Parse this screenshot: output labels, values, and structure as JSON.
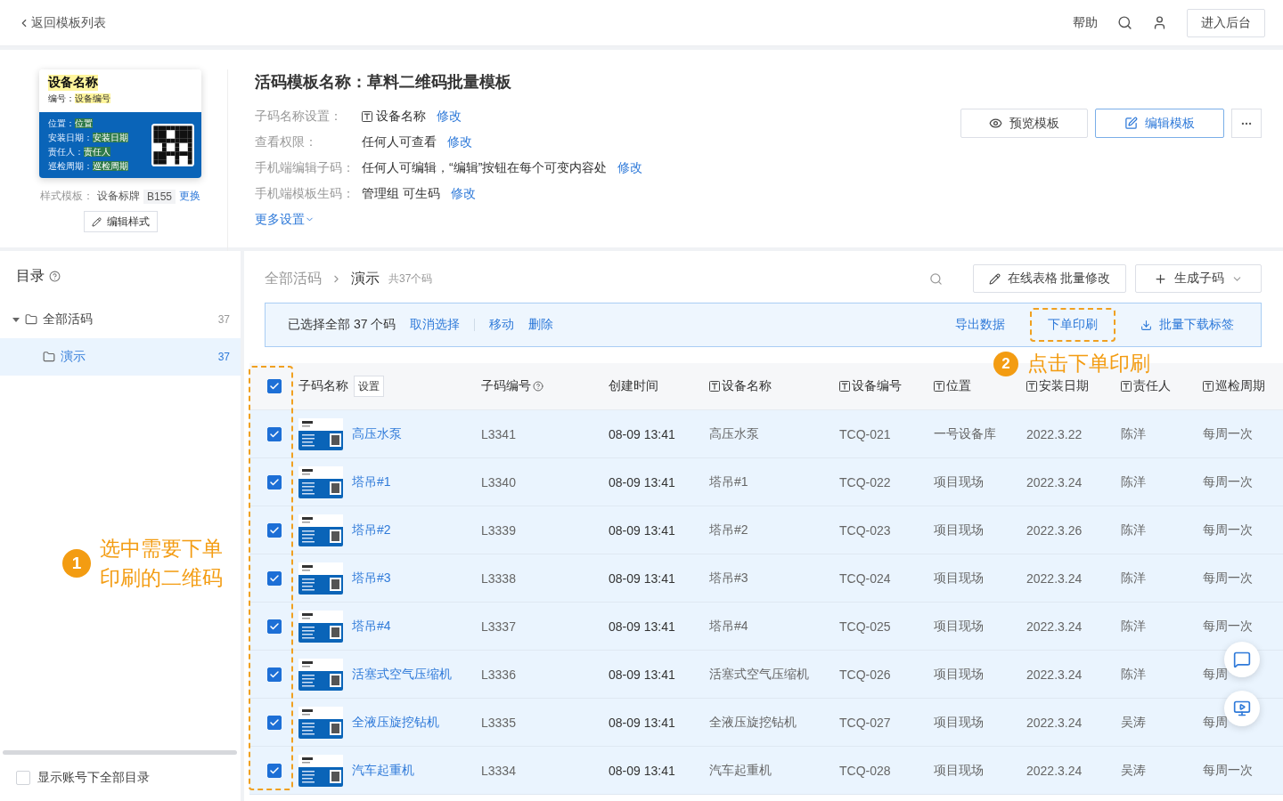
{
  "topbar": {
    "back_link": "返回模板列表",
    "help": "帮助",
    "admin_button": "进入后台"
  },
  "template": {
    "preview": {
      "title": "设备名称",
      "code_label": "编号：",
      "code_value": "设备编号",
      "fields": [
        {
          "label": "位置：",
          "value": "位置"
        },
        {
          "label": "安装日期：",
          "value": "安装日期"
        },
        {
          "label": "责任人：",
          "value": "责任人"
        },
        {
          "label": "巡检周期：",
          "value": "巡检周期"
        }
      ]
    },
    "style_label": "样式模板：",
    "style_name": "设备标牌",
    "style_code": "B155",
    "change_link": "更换",
    "edit_style_button": "编辑样式"
  },
  "info": {
    "title": "活码模板名称：草料二维码批量模板",
    "settings": [
      {
        "label": "子码名称设置：",
        "value": "设备名称",
        "field_icon": true,
        "link": "修改"
      },
      {
        "label": "查看权限：",
        "value": "任何人可查看",
        "field_icon": false,
        "link": "修改"
      },
      {
        "label": "手机端编辑子码：",
        "value": "任何人可编辑，“编辑”按钮在每个可变内容处",
        "field_icon": false,
        "link": "修改"
      },
      {
        "label": "手机端模板生码：",
        "value": "管理组 可生码",
        "field_icon": false,
        "link": "修改"
      }
    ],
    "more_link": "更多设置",
    "preview_button": "预览模板",
    "edit_button": "编辑模板"
  },
  "sidebar": {
    "title": "目录",
    "tree": [
      {
        "label": "全部活码",
        "count": "37",
        "expanded": true,
        "selected": false,
        "children": [
          {
            "label": "演示",
            "count": "37",
            "selected": true
          }
        ]
      }
    ],
    "show_all": {
      "label": "显示账号下全部目录",
      "checked": false
    }
  },
  "breadcrumb": {
    "root": "全部活码",
    "current": "演示",
    "count_note": "共37个码",
    "edit_button": "在线表格 批量修改",
    "generate_button": "生成子码"
  },
  "selection_bar": {
    "summary": "已选择全部 37 个码",
    "actions": [
      "取消选择",
      "移动",
      "删除"
    ],
    "right_actions": [
      {
        "label": "导出数据",
        "kind": "text",
        "highlighted": false
      },
      {
        "label": "下单印刷",
        "kind": "text",
        "highlighted": true
      },
      {
        "label": "批量下载标签",
        "kind": "download",
        "highlighted": false
      }
    ]
  },
  "table": {
    "all_selected": true,
    "settings_button": "设置",
    "columns": [
      {
        "label": "子码名称",
        "kind": "name"
      },
      {
        "label": "子码编号",
        "kind": "help"
      },
      {
        "label": "创建时间",
        "kind": "plain"
      },
      {
        "label": "设备名称",
        "kind": "field"
      },
      {
        "label": "设备编号",
        "kind": "field"
      },
      {
        "label": "位置",
        "kind": "field"
      },
      {
        "label": "安装日期",
        "kind": "field"
      },
      {
        "label": "责任人",
        "kind": "field"
      },
      {
        "label": "巡检周期",
        "kind": "field"
      }
    ],
    "rows": [
      {
        "selected": true,
        "cells": [
          "高压水泵",
          "L3341",
          "08-09 13:41",
          "高压水泵",
          "TCQ-021",
          "一号设备库",
          "2022.3.22",
          "陈洋",
          "每周一次"
        ]
      },
      {
        "selected": true,
        "cells": [
          "塔吊#1",
          "L3340",
          "08-09 13:41",
          "塔吊#1",
          "TCQ-022",
          "项目现场",
          "2022.3.24",
          "陈洋",
          "每周一次"
        ]
      },
      {
        "selected": true,
        "cells": [
          "塔吊#2",
          "L3339",
          "08-09 13:41",
          "塔吊#2",
          "TCQ-023",
          "项目现场",
          "2022.3.26",
          "陈洋",
          "每周一次"
        ]
      },
      {
        "selected": true,
        "cells": [
          "塔吊#3",
          "L3338",
          "08-09 13:41",
          "塔吊#3",
          "TCQ-024",
          "项目现场",
          "2022.3.24",
          "陈洋",
          "每周一次"
        ]
      },
      {
        "selected": true,
        "cells": [
          "塔吊#4",
          "L3337",
          "08-09 13:41",
          "塔吊#4",
          "TCQ-025",
          "项目现场",
          "2022.3.24",
          "陈洋",
          "每周一次"
        ]
      },
      {
        "selected": true,
        "cells": [
          "活塞式空气压缩机",
          "L3336",
          "08-09 13:41",
          "活塞式空气压缩机",
          "TCQ-026",
          "项目现场",
          "2022.3.24",
          "陈洋",
          "每周"
        ]
      },
      {
        "selected": true,
        "cells": [
          "全液压旋挖钻机",
          "L3335",
          "08-09 13:41",
          "全液压旋挖钻机",
          "TCQ-027",
          "项目现场",
          "2022.3.24",
          "吴涛",
          "每周"
        ]
      },
      {
        "selected": true,
        "cells": [
          "汽车起重机",
          "L3334",
          "08-09 13:41",
          "汽车起重机",
          "TCQ-028",
          "项目现场",
          "2022.3.24",
          "吴涛",
          "每周一次"
        ]
      }
    ]
  },
  "annotations": [
    {
      "number": "1",
      "text": "选中需要下单印刷的二维码"
    },
    {
      "number": "2",
      "text": "点击下单印刷"
    }
  ]
}
